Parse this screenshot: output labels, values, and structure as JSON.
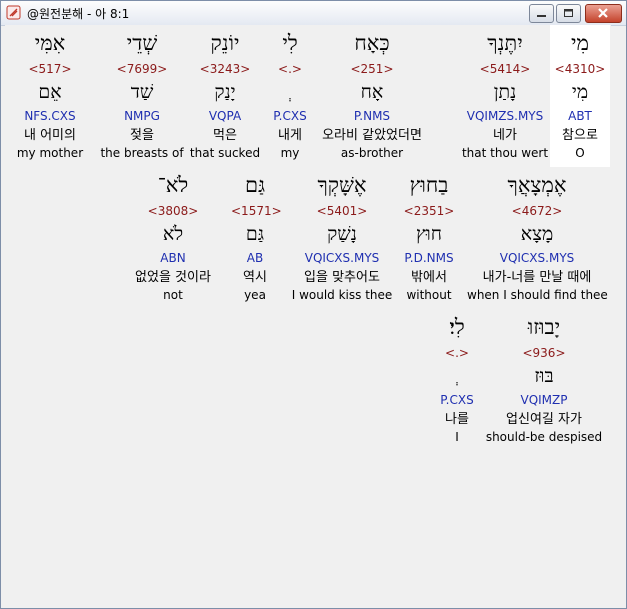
{
  "window": {
    "title": "@원전분해 - 아 8:1"
  },
  "rows": [
    [
      {
        "word": "מִי",
        "num": "<4310>",
        "root": "מִי",
        "morph": "ABT",
        "kor": "참으로",
        "eng": "O",
        "highlight": true
      },
      {
        "word": "יִתֶּנְךָ",
        "num": "<5414>",
        "root": "נָתַן",
        "morph": "VQIMZS.MYS",
        "kor": "네가",
        "eng": "that thou wert"
      },
      {
        "word": "כְּאָח",
        "num": "<251>",
        "root": "אָח",
        "morph": "P.NMS",
        "kor": "오라비 같았었더면",
        "eng": "as-brother"
      },
      {
        "word": "לִי",
        "num": "<.>",
        "root": "ְ",
        "morph": "P.CXS",
        "kor": "내게",
        "eng": "my"
      },
      {
        "word": "יוֹנֵק",
        "num": "<3243>",
        "root": "יָנַק",
        "morph": "VQPA",
        "kor": "먹은",
        "eng": "that sucked"
      },
      {
        "word": "שְׁדֵי",
        "num": "<7699>",
        "root": "שַׁד",
        "morph": "NMPG",
        "kor": "젖을",
        "eng": "the breasts of"
      },
      {
        "word": "אִמִּי",
        "num": "<517>",
        "root": "אֵם",
        "morph": "NFS.CXS",
        "kor": "내 어미의",
        "eng": "my mother"
      }
    ],
    [
      {
        "word": "אֶמְצָאֲךָ",
        "num": "<4672>",
        "root": "מָצָא",
        "morph": "VQICXS.MYS",
        "kor": "내가-너를 만날 때에",
        "eng": "when I should find thee"
      },
      {
        "word": "בַחוּץ",
        "num": "<2351>",
        "root": "חוּץ",
        "morph": "P.D.NMS",
        "kor": "밖에서",
        "eng": "without"
      },
      {
        "word": "אֶשָּׁקְךָ",
        "num": "<5401>",
        "root": "נָשַׁק",
        "morph": "VQICXS.MYS",
        "kor": "입을 맞추어도",
        "eng": "I would kiss thee"
      },
      {
        "word": "גַּם",
        "num": "<1571>",
        "root": "גַּם",
        "morph": "AB",
        "kor": "역시",
        "eng": "yea"
      },
      {
        "word": "לֹא־",
        "num": "<3808>",
        "root": "לֹא",
        "morph": "ABN",
        "kor": "없었을 것이라",
        "eng": "not"
      }
    ],
    [
      {
        "word": "יָבוּזוּ",
        "num": "<936>",
        "root": "בּוּז",
        "morph": "VQIMZP",
        "kor": "업신여길 자가",
        "eng": "should-be despised"
      },
      {
        "word": "לִי׃",
        "num": "<.>",
        "root": "ְ",
        "morph": "P.CXS",
        "kor": "나를",
        "eng": "I"
      }
    ]
  ]
}
